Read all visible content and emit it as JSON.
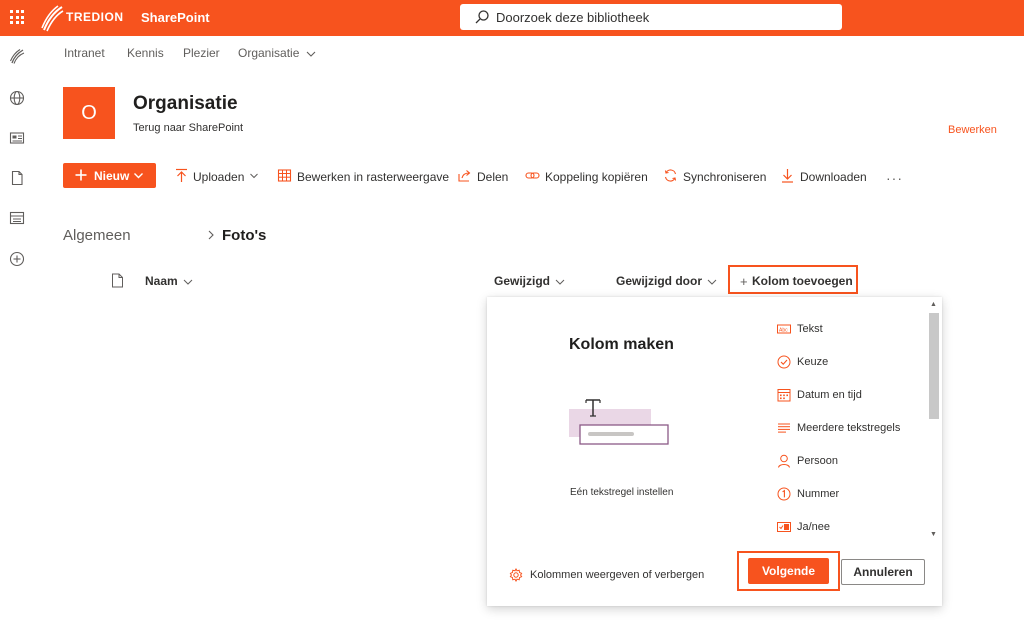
{
  "topbar": {
    "brand": "TREDION",
    "app": "SharePoint",
    "search_placeholder": "Doorzoek deze bibliotheek"
  },
  "rail": {
    "icons": [
      "tredion-logo-icon",
      "globe-icon",
      "news-icon",
      "document-icon",
      "list-icon",
      "add-circle-icon"
    ]
  },
  "hubnav": {
    "items": [
      "Intranet",
      "Kennis",
      "Plezier",
      "Organisatie"
    ]
  },
  "site": {
    "logo_letter": "O",
    "title": "Organisatie",
    "subtitle": "Terug naar SharePoint",
    "edit_label": "Bewerken"
  },
  "commandbar": {
    "new_label": "Nieuw",
    "upload": "Uploaden",
    "grid_edit": "Bewerken in rasterweergave",
    "share": "Delen",
    "copy_link": "Koppeling kopiëren",
    "sync": "Synchroniseren",
    "download": "Downloaden",
    "more": "···"
  },
  "breadcrumb": {
    "root": "Algemeen",
    "current": "Foto's"
  },
  "columns": {
    "name": "Naam",
    "modified": "Gewijzigd",
    "modified_by": "Gewijzigd door",
    "add_column": "Kolom toevoegen"
  },
  "panel": {
    "title": "Kolom maken",
    "preview_caption": "Eén tekstregel instellen",
    "types": [
      {
        "label": "Tekst",
        "icon": "text-field-icon"
      },
      {
        "label": "Keuze",
        "icon": "choice-check-icon"
      },
      {
        "label": "Datum en tijd",
        "icon": "calendar-icon"
      },
      {
        "label": "Meerdere tekstregels",
        "icon": "multiline-text-icon"
      },
      {
        "label": "Persoon",
        "icon": "person-icon"
      },
      {
        "label": "Nummer",
        "icon": "number-icon"
      },
      {
        "label": "Ja/nee",
        "icon": "toggle-icon"
      }
    ],
    "show_hide_columns": "Kolommen weergeven of verbergen",
    "next": "Volgende",
    "cancel": "Annuleren"
  },
  "colors": {
    "accent": "#f7531e",
    "text": "#323130",
    "muted": "#605e5c"
  }
}
